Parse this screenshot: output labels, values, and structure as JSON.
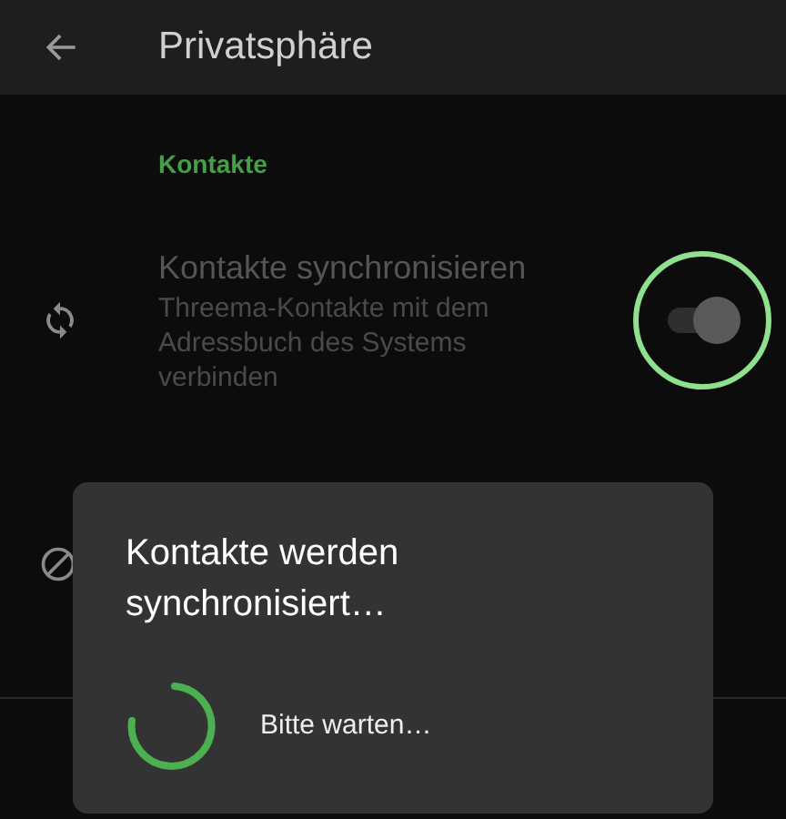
{
  "app_bar": {
    "title": "Privatsphäre"
  },
  "section": {
    "title": "Kontakte"
  },
  "setting": {
    "title": "Kontakte synchronisieren",
    "summary": "Threema-Kontakte mit dem Adressbuch des Systems verbinden",
    "checked": true,
    "disabled": true,
    "pressed": true
  },
  "dialog": {
    "title": "Kontakte werden synchronisiert…",
    "message": "Bitte warten…"
  }
}
